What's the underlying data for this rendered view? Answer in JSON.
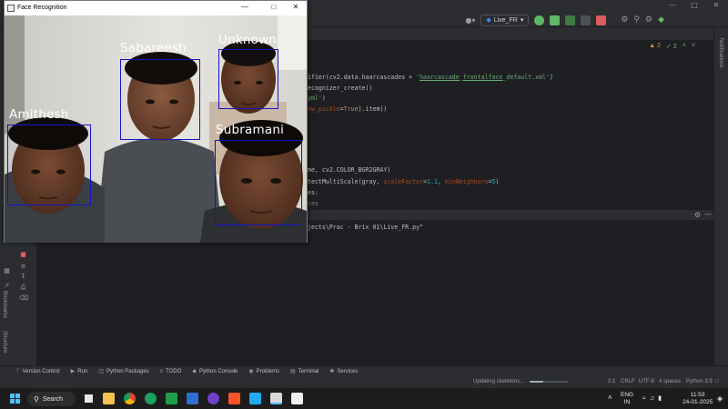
{
  "ide": {
    "run_config": "Live_FR",
    "warnings": "2",
    "ok_count": "2",
    "code_lines": [
      "ifier(cv2.data.haarcascades + 'haarcascade_frontalface_default.xml')",
      "ecognizer_create()",
      "yml')",
      "ow_pickle=True).item()",
      "me, cv2.COLOR_BGR2GRAY)",
      "tectMultiScale(gray, scaleFactor=1.1, minNeighbors=5)",
      "es:",
      "ces"
    ],
    "console_command": "jects\\Prac - Brix 01\\Live_FR.py\"",
    "right_strip": {
      "notifications": "Notifications"
    },
    "left_strip": {
      "bookmarks": "Bookmarks",
      "structure": "Structure"
    },
    "tool_tabs": [
      {
        "label": "Version Control",
        "icon": "branch-icon"
      },
      {
        "label": "Run",
        "icon": "run-icon"
      },
      {
        "label": "Python Packages",
        "icon": "packages-icon"
      },
      {
        "label": "TODO",
        "icon": "todo-icon"
      },
      {
        "label": "Python Console",
        "icon": "python-icon"
      },
      {
        "label": "Problems",
        "icon": "problems-icon"
      },
      {
        "label": "Terminal",
        "icon": "terminal-icon"
      },
      {
        "label": "Services",
        "icon": "services-icon"
      }
    ],
    "status": {
      "updating": "Updating skeletons...",
      "progress": 0.35,
      "position": "2:1",
      "line_sep": "CRLF",
      "encoding": "UTF-8",
      "indent": "4 spaces",
      "interpreter": "Python 3.9"
    }
  },
  "fr_window": {
    "title": "Face Recognition",
    "faces": [
      {
        "name": "Sabareesh"
      },
      {
        "name": "Unknown"
      },
      {
        "name": "Amithesh"
      },
      {
        "name": "Subramani"
      }
    ]
  },
  "taskbar": {
    "search_label": "Search",
    "language_top": "ENG",
    "language_bottom": "IN",
    "time": "11:53",
    "date": "24-01-2025"
  },
  "colors": {
    "face_box": "#1414c8",
    "ide_bg": "#1e1f22",
    "panel_bg": "#2b2d30",
    "taskbar_bg": "#1c1c1c"
  }
}
